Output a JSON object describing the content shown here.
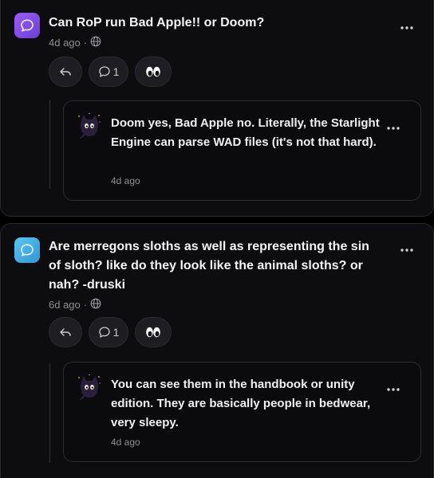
{
  "posts": [
    {
      "question": "Can RoP run Bad Apple!! or Doom?",
      "time": "4d ago",
      "separator": "·",
      "comment_count": "1",
      "reply_label": "",
      "answer": {
        "text": "Doom yes, Bad Apple no. Literally, the Starlight Engine can parse WAD files (it's not that hard).",
        "time": "4d ago"
      }
    },
    {
      "question": "Are merregons sloths as well as representing the sin of sloth? like do they look like the animal sloths? or nah? -druski",
      "time": "6d ago",
      "separator": "·",
      "comment_count": "1",
      "answer": {
        "text": "You can see them in the handbook or unity edition. They are basically people in bedwear, very sleepy.",
        "time": "4d ago"
      }
    }
  ],
  "icons": {
    "question": "chat-bubble-icon",
    "visibility": "globe-icon",
    "more": "more-horizontal-icon",
    "reply": "reply-arrow-icon",
    "comments": "comment-icon",
    "reaction": "eyes-emoji-icon",
    "avatar": "cat-avatar-icon"
  },
  "colors": {
    "question1_accent": "#9b5cf6",
    "question2_accent": "#47b3e6",
    "card_background": "#0d0d0f",
    "muted_text": "#8e8e93"
  }
}
